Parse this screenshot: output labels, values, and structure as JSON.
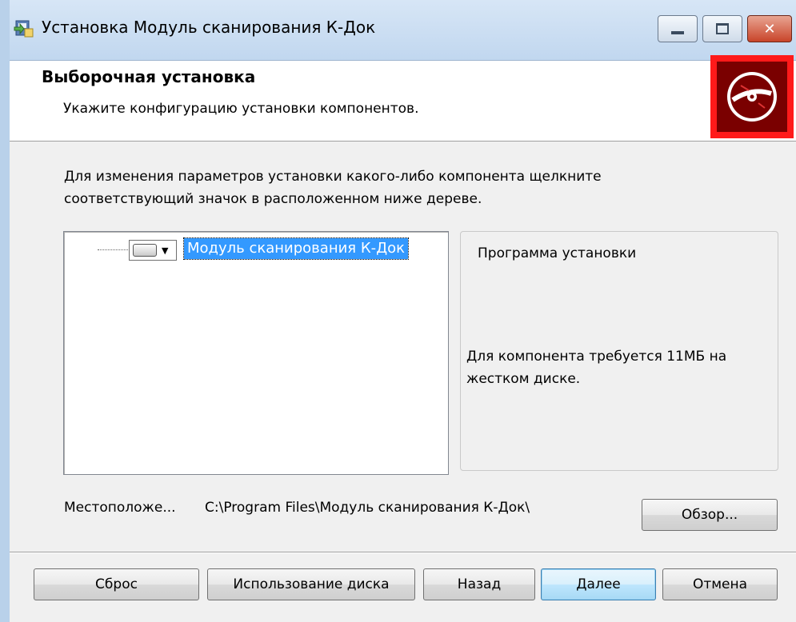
{
  "window": {
    "title": "Установка Модуль сканирования К-Док",
    "controls": [
      "minimize-icon",
      "maximize-icon",
      "close-icon"
    ]
  },
  "header": {
    "title": "Выборочная установка",
    "subtitle": "Укажите конфигурацию установки компонентов."
  },
  "instructions": "Для изменения параметров установки какого-либо компонента щелкните соответствующий значок в расположенном ниже дереве.",
  "tree": {
    "items": [
      {
        "label": "Модуль сканирования К-Док",
        "icon": "drive-icon",
        "selected": true
      }
    ]
  },
  "info_panel": {
    "title": "Программа установки",
    "size_text": "Для компонента требуется 11МБ на жестком диске."
  },
  "location": {
    "label": "Местоположе...",
    "path": "C:\\Program Files\\Модуль сканирования К-Док\\"
  },
  "buttons": {
    "browse": "Обзор...",
    "reset": "Сброс",
    "disk_usage": "Использование диска",
    "back": "Назад",
    "next": "Далее",
    "cancel": "Отмена"
  },
  "colors": {
    "selection": "#3399ff",
    "logo_red": "#ff1a1a",
    "logo_dark": "#7a0000"
  }
}
